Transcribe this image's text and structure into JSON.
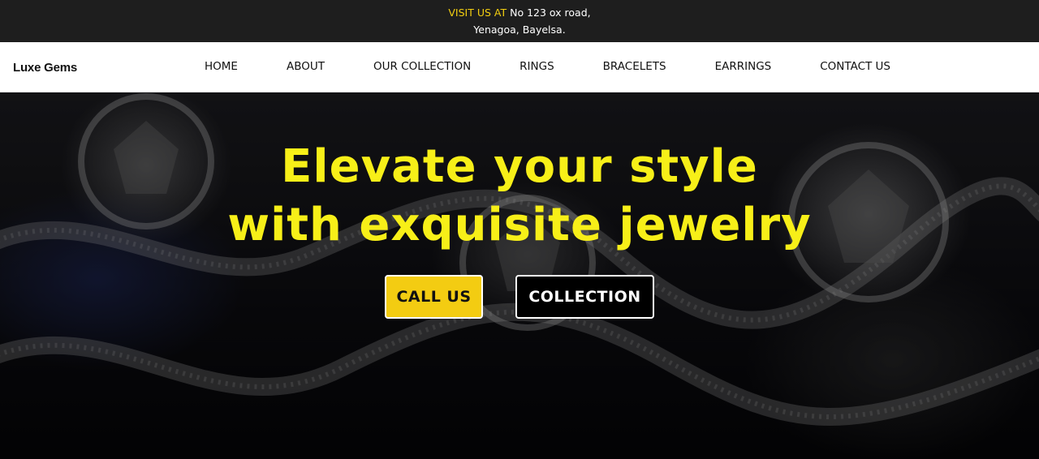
{
  "topbar": {
    "visit_label": "VISIT US AT",
    "address_line1": "No 123 ox road,",
    "address_line2": "Yenagoa, Bayelsa."
  },
  "brand": {
    "name": "Luxe Gems"
  },
  "nav": {
    "items": [
      {
        "label": "HOME"
      },
      {
        "label": "ABOUT"
      },
      {
        "label": "OUR COLLECTION"
      },
      {
        "label": "RINGS"
      },
      {
        "label": "BRACELETS"
      },
      {
        "label": "EARRINGS"
      },
      {
        "label": "CONTACT US"
      }
    ]
  },
  "hero": {
    "headline_line1": "Elevate your style",
    "headline_line2": "with exquisite jewelry",
    "call_button": "CALL US",
    "collection_button": "COLLECTION"
  },
  "colors": {
    "accent_yellow": "#f7ef18",
    "button_yellow": "#f3cc12",
    "topbar_bg": "#1e1e1e"
  }
}
